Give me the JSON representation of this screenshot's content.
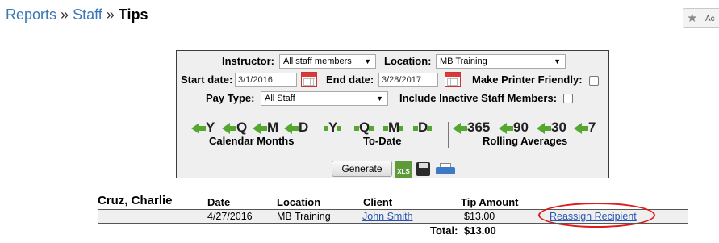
{
  "breadcrumb": {
    "items": [
      "Reports",
      "Staff"
    ],
    "current": "Tips",
    "separator": "»"
  },
  "corner_button": {
    "label": "Ac",
    "icon": "star-icon"
  },
  "filters": {
    "instructor_label": "Instructor:",
    "instructor_value": "All staff members",
    "location_label": "Location:",
    "location_value": "MB Training",
    "start_label": "Start date:",
    "start_value": "3/1/2016",
    "end_label": "End date:",
    "end_value": "3/28/2017",
    "printer_label": "Make Printer Friendly:",
    "paytype_label": "Pay Type:",
    "paytype_value": "All Staff",
    "inactive_label": "Include Inactive Staff Members:",
    "calendar_months": {
      "label": "Calendar Months",
      "buttons": [
        "Y",
        "Q",
        "M",
        "D"
      ]
    },
    "to_date": {
      "label": "To-Date",
      "buttons": [
        "Y",
        "Q",
        "M",
        "D"
      ]
    },
    "rolling": {
      "label": "Rolling Averages",
      "buttons": [
        "365",
        "90",
        "30",
        "7"
      ]
    },
    "generate_label": "Generate",
    "xls_label": "XLS"
  },
  "report": {
    "staff_name": "Cruz, Charlie",
    "headers": {
      "date": "Date",
      "location": "Location",
      "client": "Client",
      "tip": "Tip Amount"
    },
    "rows": [
      {
        "date": "4/27/2016",
        "location": "MB Training",
        "client": "John Smith",
        "tip": "$13.00",
        "action": "Reassign Recipient"
      }
    ],
    "total_label": "Total:",
    "total_value": "$13.00"
  },
  "colors": {
    "link": "#3a77b5",
    "arrow_green": "#54a82f",
    "highlight": "#e0191b"
  }
}
